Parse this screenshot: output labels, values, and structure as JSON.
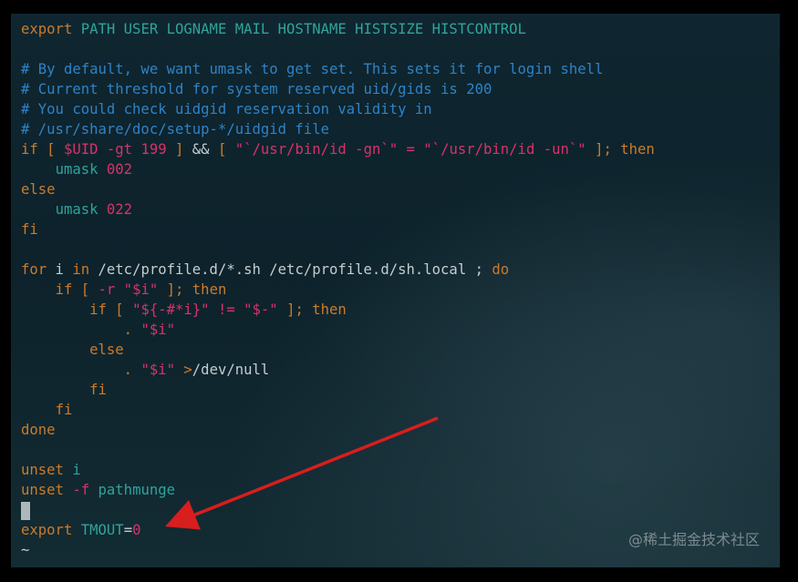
{
  "terminal": {
    "lines": [
      [
        {
          "c": "kw",
          "t": "export"
        },
        {
          "c": "var",
          "t": " PATH USER LOGNAME MAIL HOSTNAME HISTSIZE HISTCONTROL"
        }
      ],
      [],
      [
        {
          "c": "cm",
          "t": "# By default, we want umask to get set. This sets it for login shell"
        }
      ],
      [
        {
          "c": "cm",
          "t": "# Current threshold for system reserved uid/gids is 200"
        }
      ],
      [
        {
          "c": "cm",
          "t": "# You could check uidgid reservation validity in"
        }
      ],
      [
        {
          "c": "cm",
          "t": "# /usr/share/doc/setup-*/uidgid file"
        }
      ],
      [
        {
          "c": "kw",
          "t": "if"
        },
        {
          "c": "txt",
          "t": " "
        },
        {
          "c": "kw",
          "t": "["
        },
        {
          "c": "txt",
          "t": " "
        },
        {
          "c": "str",
          "t": "$UID -gt 199"
        },
        {
          "c": "txt",
          "t": " "
        },
        {
          "c": "kw",
          "t": "]"
        },
        {
          "c": "txt",
          "t": " && "
        },
        {
          "c": "kw",
          "t": "["
        },
        {
          "c": "txt",
          "t": " "
        },
        {
          "c": "str",
          "t": "\"`/usr/bin/id -gn`\" = \"`/usr/bin/id -un`\""
        },
        {
          "c": "txt",
          "t": " "
        },
        {
          "c": "kw",
          "t": "]; then"
        }
      ],
      [
        {
          "c": "txt",
          "t": "    "
        },
        {
          "c": "var",
          "t": "umask"
        },
        {
          "c": "str",
          "t": " 002"
        }
      ],
      [
        {
          "c": "kw",
          "t": "else"
        }
      ],
      [
        {
          "c": "txt",
          "t": "    "
        },
        {
          "c": "var",
          "t": "umask"
        },
        {
          "c": "str",
          "t": " 022"
        }
      ],
      [
        {
          "c": "kw",
          "t": "fi"
        }
      ],
      [],
      [
        {
          "c": "kw",
          "t": "for"
        },
        {
          "c": "txt",
          "t": " i "
        },
        {
          "c": "kw",
          "t": "in"
        },
        {
          "c": "txt",
          "t": " /etc/profile.d/*.sh /etc/profile.d/sh.local ; "
        },
        {
          "c": "kw",
          "t": "do"
        }
      ],
      [
        {
          "c": "txt",
          "t": "    "
        },
        {
          "c": "kw",
          "t": "if"
        },
        {
          "c": "txt",
          "t": " "
        },
        {
          "c": "kw",
          "t": "["
        },
        {
          "c": "str",
          "t": " -r \"$i\""
        },
        {
          "c": "txt",
          "t": " "
        },
        {
          "c": "kw",
          "t": "]; then"
        }
      ],
      [
        {
          "c": "txt",
          "t": "        "
        },
        {
          "c": "kw",
          "t": "if"
        },
        {
          "c": "txt",
          "t": " "
        },
        {
          "c": "kw",
          "t": "["
        },
        {
          "c": "txt",
          "t": " "
        },
        {
          "c": "str",
          "t": "\"${-#*i}\" != \"$-\""
        },
        {
          "c": "txt",
          "t": " "
        },
        {
          "c": "kw",
          "t": "]; then"
        }
      ],
      [
        {
          "c": "txt",
          "t": "            "
        },
        {
          "c": "kw",
          "t": "."
        },
        {
          "c": "str",
          "t": " \"$i\""
        }
      ],
      [
        {
          "c": "txt",
          "t": "        "
        },
        {
          "c": "kw",
          "t": "else"
        }
      ],
      [
        {
          "c": "txt",
          "t": "            "
        },
        {
          "c": "kw",
          "t": "."
        },
        {
          "c": "str",
          "t": " \"$i\""
        },
        {
          "c": "txt",
          "t": " "
        },
        {
          "c": "kw",
          "t": ">"
        },
        {
          "c": "txt",
          "t": "/dev/null"
        }
      ],
      [
        {
          "c": "txt",
          "t": "        "
        },
        {
          "c": "kw",
          "t": "fi"
        }
      ],
      [
        {
          "c": "txt",
          "t": "    "
        },
        {
          "c": "kw",
          "t": "fi"
        }
      ],
      [
        {
          "c": "kw",
          "t": "done"
        }
      ],
      [],
      [
        {
          "c": "kw",
          "t": "unset"
        },
        {
          "c": "var",
          "t": " i"
        }
      ],
      [
        {
          "c": "kw",
          "t": "unset"
        },
        {
          "c": "str",
          "t": " -f"
        },
        {
          "c": "var",
          "t": " pathmunge"
        }
      ],
      [
        {
          "c": "cursor",
          "t": ""
        }
      ],
      [
        {
          "c": "kw",
          "t": "export"
        },
        {
          "c": "var",
          "t": " TMOUT"
        },
        {
          "c": "txt",
          "t": "="
        },
        {
          "c": "str",
          "t": "0"
        }
      ],
      [
        {
          "c": "txt",
          "t": "~"
        }
      ]
    ]
  },
  "annotation": {
    "arrow_color": "#d81e1e"
  },
  "watermark": "@稀土掘金技术社区",
  "colors": {
    "background": "#0f2630",
    "keyword": "#cb7b2a",
    "variable": "#2fa49a",
    "comment": "#2e82c6",
    "string": "#d6336b",
    "text": "#c3cdd0"
  }
}
